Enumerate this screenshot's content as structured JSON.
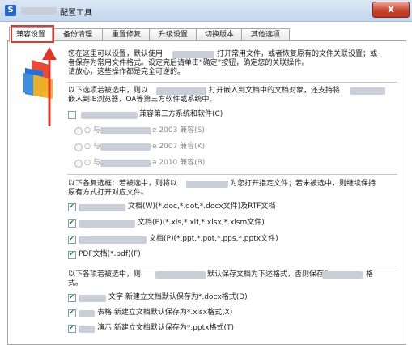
{
  "window": {
    "title": "配置工具",
    "close_label": "x"
  },
  "tabs": [
    {
      "label": "兼容设置",
      "active": true
    },
    {
      "label": "备份清理"
    },
    {
      "label": "重置修复"
    },
    {
      "label": "升级设置"
    },
    {
      "label": "切换版本"
    },
    {
      "label": "其他选项"
    }
  ],
  "intro": {
    "line1_a": "您在这里可以设置，默认使用",
    "line1_b": "打开常用文件，或者恢复原有的文件关联设置；或",
    "line2": "者保存为常用文件格式。设定完后请单击“确定”按钮，确定您的关联操作。",
    "line3": "请放心，这些操作都是完全可逆的。"
  },
  "embed": {
    "line1_a": "以下选项若被选中，则以",
    "line1_b": "打开嵌入到文档中的文档对象，还支持将",
    "line2": "嵌入到IE浏览器、OA等第三方软件或系统中。",
    "compat_label": "兼容第三方系统和软件(C)",
    "compat_checked": false,
    "radio_prefix": "○ 与",
    "radios": [
      {
        "label": "e 2003 兼容(S)"
      },
      {
        "label": "e 2007 兼容(K)"
      },
      {
        "label": "a 2010 兼容(B)"
      }
    ]
  },
  "assoc": {
    "line1_a": "以下各复选框：若被选中，则将以",
    "line1_b": "为您打开指定文件；若未被选中，则继续保持",
    "line2": "原有方式打开对应文件。",
    "items": [
      {
        "label": "文档(W)(*.doc,*.dot,*.docx文件)及RTF文档",
        "checked": true
      },
      {
        "label": "文档(E)(*.xls,*.xlt,*.xlsx,*.xlsm文件)",
        "checked": true
      },
      {
        "label": "文档(P)(*.ppt,*.pot,*.pps,*.pptx文件)",
        "checked": true
      },
      {
        "label": "PDF文档(*.pdf)(F)",
        "checked": true
      }
    ]
  },
  "save": {
    "line1_a": "以下各项若被选中，则",
    "line1_b": "默认保存文档为下述格式，否则保存为",
    "line1_c": "格",
    "line2": "式。",
    "items": [
      {
        "label": "文字 新建立文档默认保存为*.docx格式(D)",
        "checked": true
      },
      {
        "label": "表格 新建立文档默认保存为*.xlsx格式(X)",
        "checked": true
      },
      {
        "label": "演示 新建立文档默认保存为*.pptx格式(T)",
        "checked": true
      }
    ]
  }
}
